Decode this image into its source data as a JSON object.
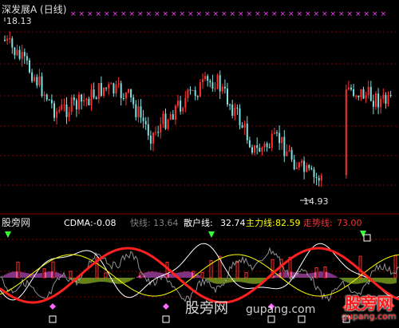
{
  "main_panel": {
    "symbol_label": "深发展A (日线)",
    "max_price_label": "18.13",
    "min_price_label": "14.93",
    "price_range": [
      14.5,
      18.5
    ],
    "colors": {
      "up": "#ff3030",
      "down": "#7fe0e0",
      "grid": "#8b0000",
      "marker": "#ff40ff"
    }
  },
  "indicator_panel": {
    "name": "股旁网",
    "cdma_label": "CDMA:",
    "cdma_value": "-0.08",
    "fast_label": "快线:",
    "fast_value": "13.64",
    "retail_label": "散户线:",
    "retail_value": "32.74",
    "main_label": "主力线:",
    "main_value": "82.59",
    "trend_label": "走势线:",
    "trend_value": "73.00",
    "colors": {
      "cdma": "#ffffff",
      "fast": "#808080",
      "retail": "#ffffff",
      "main": "#ffff00",
      "trend": "#ff3030"
    }
  },
  "watermarks": {
    "site_cn": "股旁网",
    "site_url": "gupang.com",
    "badge_title": "股旁网",
    "badge_url": "gupang.com"
  },
  "chart_data": {
    "type": "candlestick",
    "title": "深发展A (日线)",
    "price_high_marker": 18.13,
    "price_low_marker": 14.93,
    "ylim": [
      14.5,
      18.5
    ],
    "indicators": {
      "CDMA": -0.08,
      "快线": 13.64,
      "散户线": 32.74,
      "主力线": 82.59,
      "走势线": 73.0
    }
  }
}
